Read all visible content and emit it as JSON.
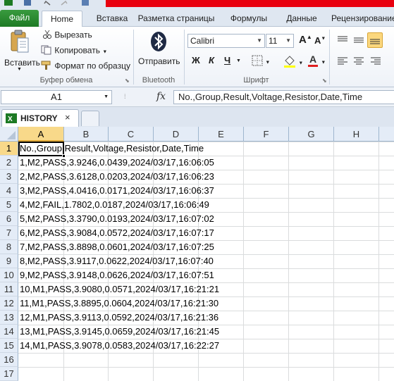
{
  "ribbon_tabs": [
    {
      "label": "Файл"
    },
    {
      "label": "Home"
    },
    {
      "label": "Вставка"
    },
    {
      "label": "Разметка страницы"
    },
    {
      "label": "Формулы"
    },
    {
      "label": "Данные"
    },
    {
      "label": "Рецензирование"
    }
  ],
  "clipboard": {
    "paste": "Вставить",
    "cut": "Вырезать",
    "copy": "Копировать",
    "format_painter": "Формат по образцу",
    "group": "Буфер обмена"
  },
  "bluetooth": {
    "send": "Отправить",
    "group": "Bluetooth"
  },
  "font": {
    "name": "Calibri",
    "size": "11",
    "bold": "Ж",
    "italic": "К",
    "underline": "Ч",
    "group": "Шрифт"
  },
  "formula_bar": {
    "name_box": "A1",
    "fx": "fx",
    "formula": "No.,Group,Result,Voltage,Resistor,Date,Time"
  },
  "workbook_tab": {
    "name": "HISTORY",
    "close": "×"
  },
  "columns": [
    "A",
    "B",
    "C",
    "D",
    "E",
    "F",
    "G",
    "H"
  ],
  "rows": [
    "1",
    "2",
    "3",
    "4",
    "5",
    "6",
    "7",
    "8",
    "9",
    "10",
    "11",
    "12",
    "13",
    "14",
    "15",
    "16",
    "17"
  ],
  "cells": [
    "No.,Group,Result,Voltage,Resistor,Date,Time",
    "1,M2,PASS,3.9246,0.0439,2024/03/17,16:06:05",
    "2,M2,PASS,3.6128,0.0203,2024/03/17,16:06:23",
    "3,M2,PASS,4.0416,0.0171,2024/03/17,16:06:37",
    "4,M2,FAIL,1.7802,0.0187,2024/03/17,16:06:49",
    "5,M2,PASS,3.3790,0.0193,2024/03/17,16:07:02",
    "6,M2,PASS,3.9084,0.0572,2024/03/17,16:07:17",
    "7,M2,PASS,3.8898,0.0601,2024/03/17,16:07:25",
    "8,M2,PASS,3.9117,0.0622,2024/03/17,16:07:40",
    "9,M2,PASS,3.9148,0.0626,2024/03/17,16:07:51",
    "10,M1,PASS,3.9080,0.0571,2024/03/17,16:21:21",
    "11,M1,PASS,3.8895,0.0604,2024/03/17,16:21:30",
    "12,M1,PASS,3.9113,0.0592,2024/03/17,16:21:36",
    "13,M1,PASS,3.9145,0.0659,2024/03/17,16:21:45",
    "14,M1,PASS,3.9078,0.0583,2024/03/17,16:22:27"
  ],
  "colors": {
    "file_tab": "#1d7a24",
    "title_red": "#e8000e",
    "header_active": "#f8d98a"
  }
}
